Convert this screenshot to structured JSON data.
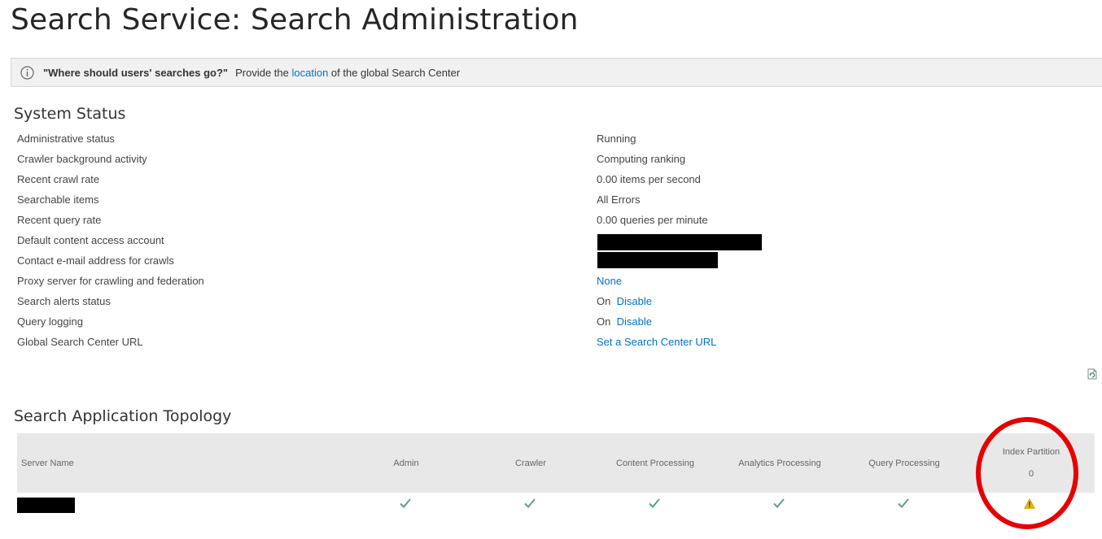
{
  "page": {
    "title": "Search Service: Search Administration"
  },
  "info_bar": {
    "icon": "info-icon",
    "question": "\"Where should users' searches go?\"",
    "text_before": "Provide the",
    "link": "location",
    "text_after": "of the global Search Center"
  },
  "system_status": {
    "heading": "System Status",
    "rows": [
      {
        "label": "Administrative status",
        "value": "Running"
      },
      {
        "label": "Crawler background activity",
        "value": "Computing ranking"
      },
      {
        "label": "Recent crawl rate",
        "value": "0.00 items per second"
      },
      {
        "label": "Searchable items",
        "value": "All Errors"
      },
      {
        "label": "Recent query rate",
        "value": "0.00 queries per minute"
      },
      {
        "label": "Default content access account",
        "value": ""
      },
      {
        "label": "Contact e-mail address for crawls",
        "value": ""
      },
      {
        "label": "Proxy server for crawling and federation",
        "value": "None"
      },
      {
        "label": "Search alerts status",
        "value": "On",
        "action": "Disable"
      },
      {
        "label": "Query logging",
        "value": "On",
        "action": "Disable"
      },
      {
        "label": "Global Search Center URL",
        "value": "Set a Search Center URL"
      }
    ]
  },
  "topology": {
    "heading": "Search Application Topology",
    "columns": [
      "Server Name",
      "Admin",
      "Crawler",
      "Content Processing",
      "Analytics Processing",
      "Query Processing",
      "Index Partition"
    ],
    "index_partition_number": "0",
    "row": {
      "server_name": "",
      "status_icons": [
        "check-icon",
        "check-icon",
        "check-icon",
        "check-icon",
        "check-icon",
        "warning-icon"
      ]
    }
  },
  "colors": {
    "link": "#0072c6",
    "check": "#5a9e8f",
    "warning": "#e8b400",
    "annotation": "#e60000"
  }
}
